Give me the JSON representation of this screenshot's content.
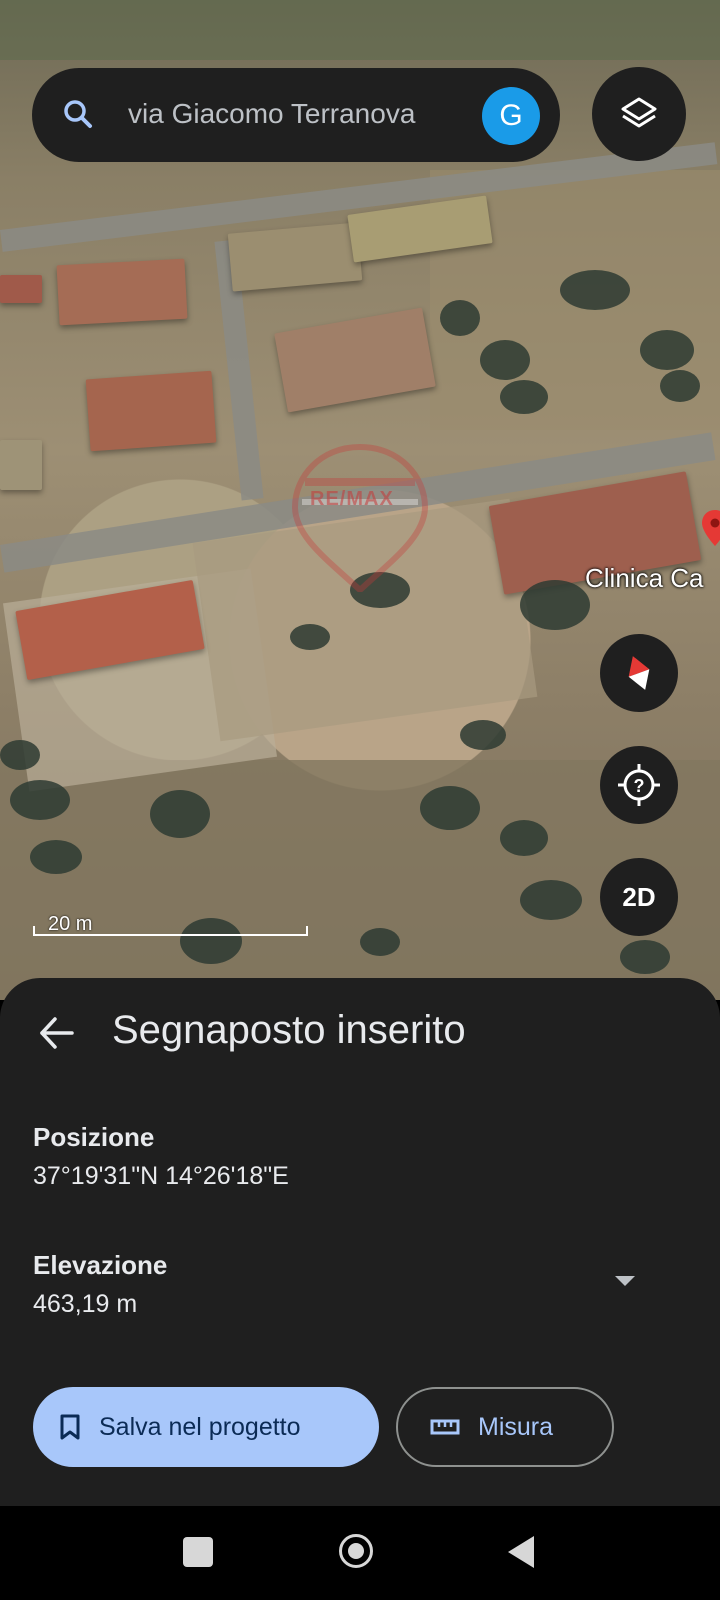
{
  "search": {
    "query": "via Giacomo Terranova",
    "account_initial": "G"
  },
  "map": {
    "watermark": "RE/MAX",
    "place_label": "Clinica Ca",
    "scale_label": "20 m",
    "view_toggle": "2D"
  },
  "sheet": {
    "title": "Segnaposto inserito",
    "position_label": "Posizione",
    "position_value": "37°19'31\"N 14°26'18\"E",
    "elevation_label": "Elevazione",
    "elevation_value": "463,19 m",
    "save_button": "Salva nel progetto",
    "measure_button": "Misura"
  },
  "colors": {
    "sheet_bg": "#1f1f1f",
    "primary_button": "#a8c7fa",
    "avatar": "#1a9be8",
    "pin": "#e53935"
  },
  "icons": [
    "search-icon",
    "layers-icon",
    "compass-icon",
    "locate-help-icon",
    "back-arrow-icon",
    "bookmark-icon",
    "ruler-icon",
    "map-pin-icon"
  ]
}
